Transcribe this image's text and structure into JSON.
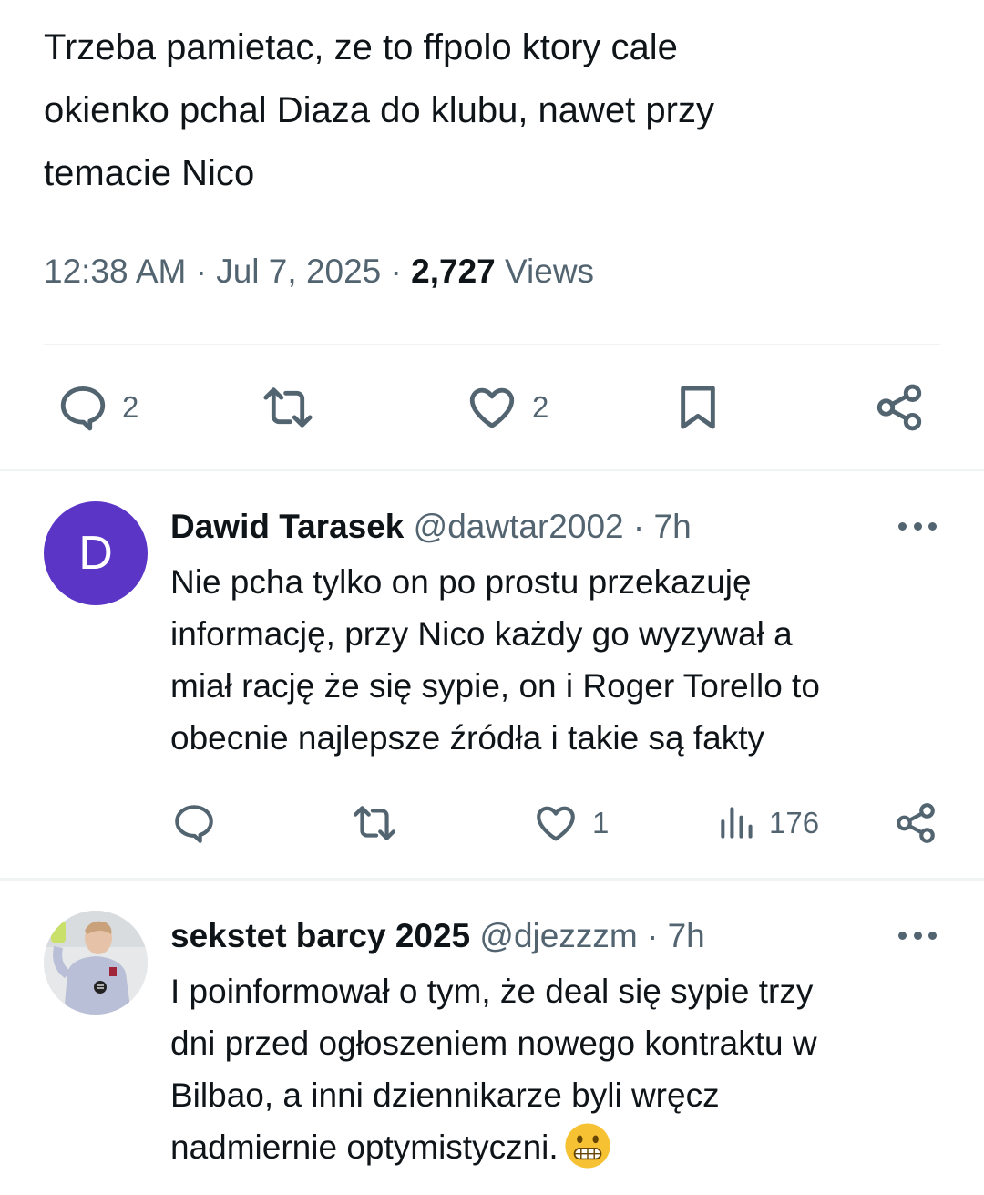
{
  "main_post": {
    "text": "Trzeba pamietac, ze to ffpolo ktory cale\nokienko pchal Diaza do klubu, nawet przy\ntemacie Nico",
    "time": "12:38 AM",
    "date": "Jul 7, 2025",
    "separator": "·",
    "views_count": "2,727",
    "views_label": "Views",
    "actions": {
      "reply_count": "2",
      "like_count": "2"
    }
  },
  "replies": [
    {
      "avatar_letter": "D",
      "name": "Dawid Tarasek",
      "handle": "@dawtar2002",
      "separator": "·",
      "age": "7h",
      "text": "Nie pcha tylko on po prostu przekazuję\ninformację, przy Nico każdy go wyzywał a\nmiał rację że się sypie, on i Roger Torello to\nobecnie najlepsze źródła i takie są fakty",
      "like_count": "1",
      "view_count": "176"
    },
    {
      "name": "sekstet barcy 2025",
      "handle": "@djezzzm",
      "separator": "·",
      "age": "7h",
      "text": "I poinformował o tym, że deal się sypie trzy\ndni przed ogłoszeniem nowego kontraktu w\nBilbao, a inni dziennikarze byli wręcz\nnadmiernie optymistyczni."
    }
  ],
  "colors": {
    "text_primary": "#0f1419",
    "text_secondary": "#536471",
    "divider": "#eff3f4",
    "avatar_purple": "#5b35c6"
  },
  "icons": {
    "reply": "speech-bubble-icon",
    "repost": "repost-arrows-icon",
    "like": "heart-icon",
    "bookmark": "bookmark-icon",
    "share": "share-nodes-icon",
    "views": "bar-chart-icon",
    "more": "more-dots-icon",
    "emoji": "grimacing-face-emoji"
  }
}
